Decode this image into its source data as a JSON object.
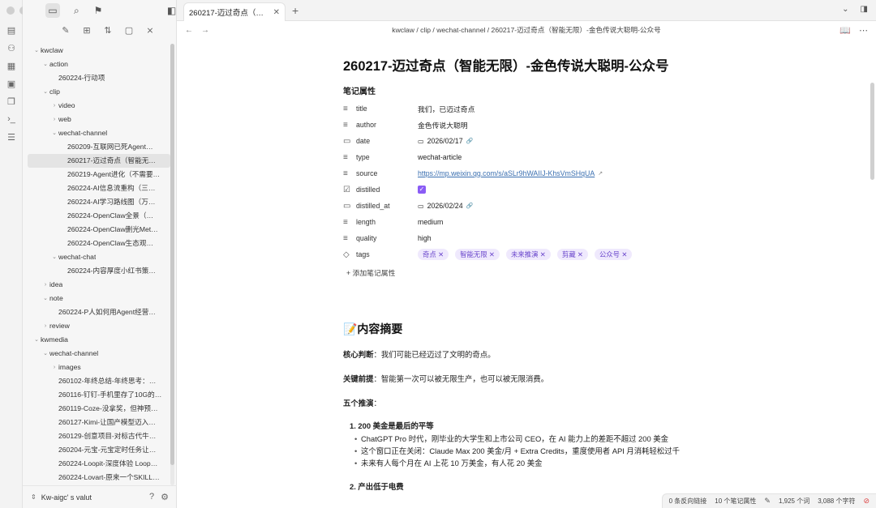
{
  "sidebar": {
    "tree": [
      {
        "label": "kwclaw",
        "depth": 0,
        "chev": "down"
      },
      {
        "label": "action",
        "depth": 1,
        "chev": "down"
      },
      {
        "label": "260224-行动项",
        "depth": 2,
        "chev": ""
      },
      {
        "label": "clip",
        "depth": 1,
        "chev": "down"
      },
      {
        "label": "video",
        "depth": 2,
        "chev": "right"
      },
      {
        "label": "web",
        "depth": 2,
        "chev": "right"
      },
      {
        "label": "wechat-channel",
        "depth": 2,
        "chev": "down"
      },
      {
        "label": "260209-互联网已死Agent…",
        "depth": 3,
        "chev": ""
      },
      {
        "label": "260217-迈过奇点（智能无…",
        "depth": 3,
        "chev": "",
        "selected": true
      },
      {
        "label": "260219-Agent进化（不需要…",
        "depth": 3,
        "chev": ""
      },
      {
        "label": "260224-AI信息流重构（三…",
        "depth": 3,
        "chev": ""
      },
      {
        "label": "260224-AI学习路线图（万…",
        "depth": 3,
        "chev": ""
      },
      {
        "label": "260224-OpenClaw全景（…",
        "depth": 3,
        "chev": ""
      },
      {
        "label": "260224-OpenClaw删光Met…",
        "depth": 3,
        "chev": ""
      },
      {
        "label": "260224-OpenClaw生态观…",
        "depth": 3,
        "chev": ""
      },
      {
        "label": "wechat-chat",
        "depth": 2,
        "chev": "down"
      },
      {
        "label": "260224-内容厚度小红书策…",
        "depth": 3,
        "chev": ""
      },
      {
        "label": "idea",
        "depth": 1,
        "chev": "right"
      },
      {
        "label": "note",
        "depth": 1,
        "chev": "down"
      },
      {
        "label": "260224-P人如何用Agent经营…",
        "depth": 2,
        "chev": ""
      },
      {
        "label": "review",
        "depth": 1,
        "chev": "right"
      },
      {
        "label": "kwmedia",
        "depth": 0,
        "chev": "down"
      },
      {
        "label": "wechat-channel",
        "depth": 1,
        "chev": "down"
      },
      {
        "label": "images",
        "depth": 2,
        "chev": "right"
      },
      {
        "label": "260102-年终总结-年终思考：…",
        "depth": 2,
        "chev": ""
      },
      {
        "label": "260116-钉钉-手机里存了10G的…",
        "depth": 2,
        "chev": ""
      },
      {
        "label": "260119-Coze-没拿奖，但神预…",
        "depth": 2,
        "chev": ""
      },
      {
        "label": "260127-Kimi-让国产模型迈入…",
        "depth": 2,
        "chev": ""
      },
      {
        "label": "260129-创意项目-对标古代牛…",
        "depth": 2,
        "chev": ""
      },
      {
        "label": "260204-元宝-元宝定时任务让…",
        "depth": 2,
        "chev": ""
      },
      {
        "label": "260224-Loopit-深度体验 Loop…",
        "depth": 2,
        "chev": ""
      },
      {
        "label": "260224-Lovart-原来一个SKILL…",
        "depth": 2,
        "chev": ""
      }
    ],
    "vault_name": "Kw-aigc' s valut"
  },
  "tab": {
    "label": "260217-迈过奇点（智能…",
    "close": "✕",
    "add": "+"
  },
  "breadcrumb": "kwclaw / clip / wechat-channel / 260217-迈过奇点（智能无限）-金色传说大聪明-公众号",
  "doc": {
    "title": "260217-迈过奇点（智能无限）-金色传说大聪明-公众号",
    "props_heading": "笔记属性",
    "properties": [
      {
        "icon": "≡",
        "name": "title",
        "value": "我们，已迈过奇点"
      },
      {
        "icon": "≡",
        "name": "author",
        "value": "金色传说大聪明"
      },
      {
        "icon": "▭",
        "name": "date",
        "value": "2026/02/17",
        "kind": "date"
      },
      {
        "icon": "≡",
        "name": "type",
        "value": "wechat-article"
      },
      {
        "icon": "≡",
        "name": "source",
        "value": "https://mp.weixin.qq.com/s/aSLr9hWAIIJ-KhsVmSHqUA",
        "kind": "link"
      },
      {
        "icon": "☑",
        "name": "distilled",
        "value": "",
        "kind": "check"
      },
      {
        "icon": "▭",
        "name": "distilled_at",
        "value": "2026/02/24",
        "kind": "date"
      },
      {
        "icon": "≡",
        "name": "length",
        "value": "medium"
      },
      {
        "icon": "≡",
        "name": "quality",
        "value": "high"
      },
      {
        "icon": "◇",
        "name": "tags",
        "kind": "tags",
        "tags": [
          "奇点",
          "智能无限",
          "未来推演",
          "剪藏",
          "公众号"
        ]
      }
    ],
    "add_property": "+ 添加笔记属性",
    "summary_heading": "📝内容摘要",
    "core_label": "核心判断",
    "core_text": "：我们可能已经迈过了文明的奇点。",
    "premise_label": "关键前提",
    "premise_text": "：智能第一次可以被无限生产，也可以被无限消费。",
    "five_label": "五个推演",
    "five_colon": "：",
    "list_item_1": "1. 200 美金是最后的平等",
    "bullets": [
      "ChatGPT Pro 时代，刚毕业的大学生和上市公司 CEO，在 AI 能力上的差距不超过 200 美金",
      "这个窗口正在关闭：Claude Max 200 美金/月 + Extra Credits，重度使用者 API 月消耗轻松过千",
      "未来有人每个月在 AI 上花 10 万美金，有人花 20 美金"
    ],
    "list_item_2": "2. 产出低于电费"
  },
  "status": {
    "backlinks": "0 条反向链接",
    "props_count": "10 个笔记属性",
    "words": "1,925 个词",
    "chars": "3,088 个字符"
  },
  "colors": {
    "accent": "#8a5cf5",
    "link": "#3a6fb0",
    "tag_bg": "#efe9fd"
  }
}
